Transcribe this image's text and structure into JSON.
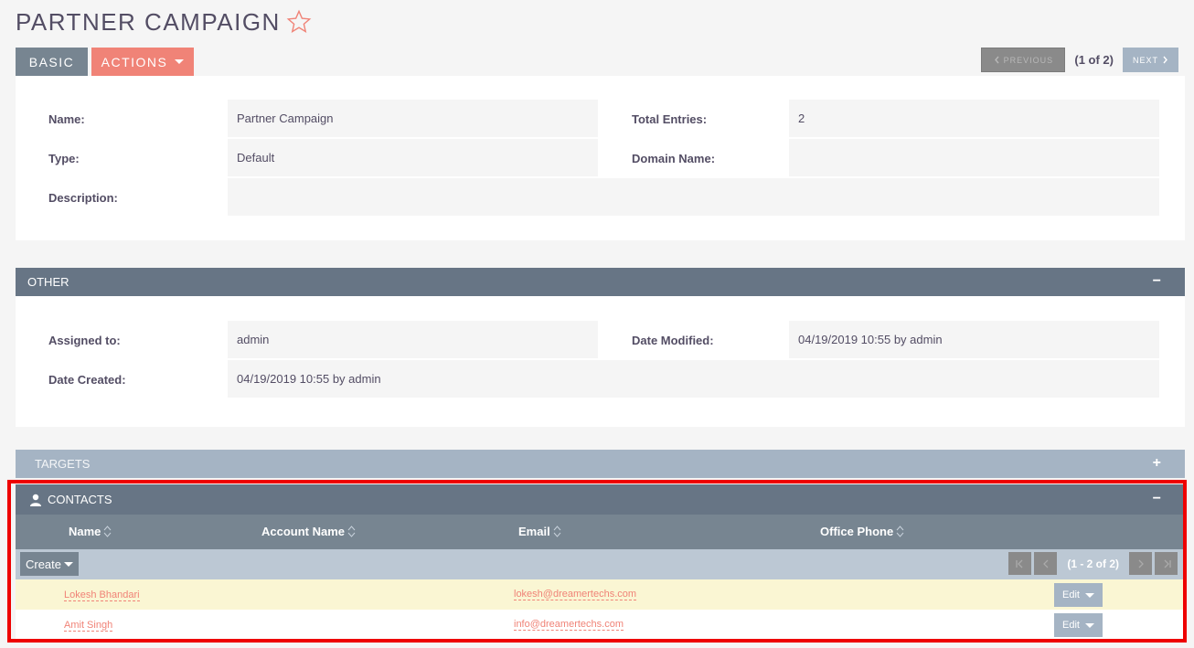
{
  "header": {
    "title": "PARTNER CAMPAIGN",
    "favorite_icon": "star-outline-icon"
  },
  "tabs": [
    {
      "label": "BASIC"
    },
    {
      "label": "ACTIONS"
    }
  ],
  "pager": {
    "previous_label": "PREVIOUS",
    "count": "(1 of 2)",
    "next_label": "NEXT"
  },
  "basic": {
    "name_label": "Name:",
    "name_value": "Partner Campaign",
    "total_label": "Total Entries:",
    "total_value": "2",
    "type_label": "Type:",
    "type_value": "Default",
    "domain_label": "Domain Name:",
    "domain_value": "",
    "description_label": "Description:",
    "description_value": ""
  },
  "other": {
    "title": "OTHER",
    "toggle": "−",
    "assigned_label": "Assigned to:",
    "assigned_value": "admin",
    "modified_label": "Date Modified:",
    "modified_value": "04/19/2019 10:55 by admin",
    "created_label": "Date Created:",
    "created_value": "04/19/2019 10:55 by admin"
  },
  "targets": {
    "title": "TARGETS",
    "toggle": "+"
  },
  "contacts": {
    "title": "CONTACTS",
    "toggle": "−",
    "columns": [
      "Name",
      "Account Name",
      "Email",
      "Office Phone"
    ],
    "create_label": "Create",
    "pager_count": "(1 - 2 of 2)",
    "rows": [
      {
        "name": "Lokesh Bhandari",
        "account": "",
        "email": "lokesh@dreamertechs.com",
        "phone": "",
        "action": "Edit"
      },
      {
        "name": "Amit Singh",
        "account": "",
        "email": "info@dreamertechs.com",
        "phone": "",
        "action": "Edit"
      }
    ]
  },
  "colors": {
    "accent": "#f08377",
    "panel_header": "#677585",
    "highlight": "#ee0000"
  }
}
